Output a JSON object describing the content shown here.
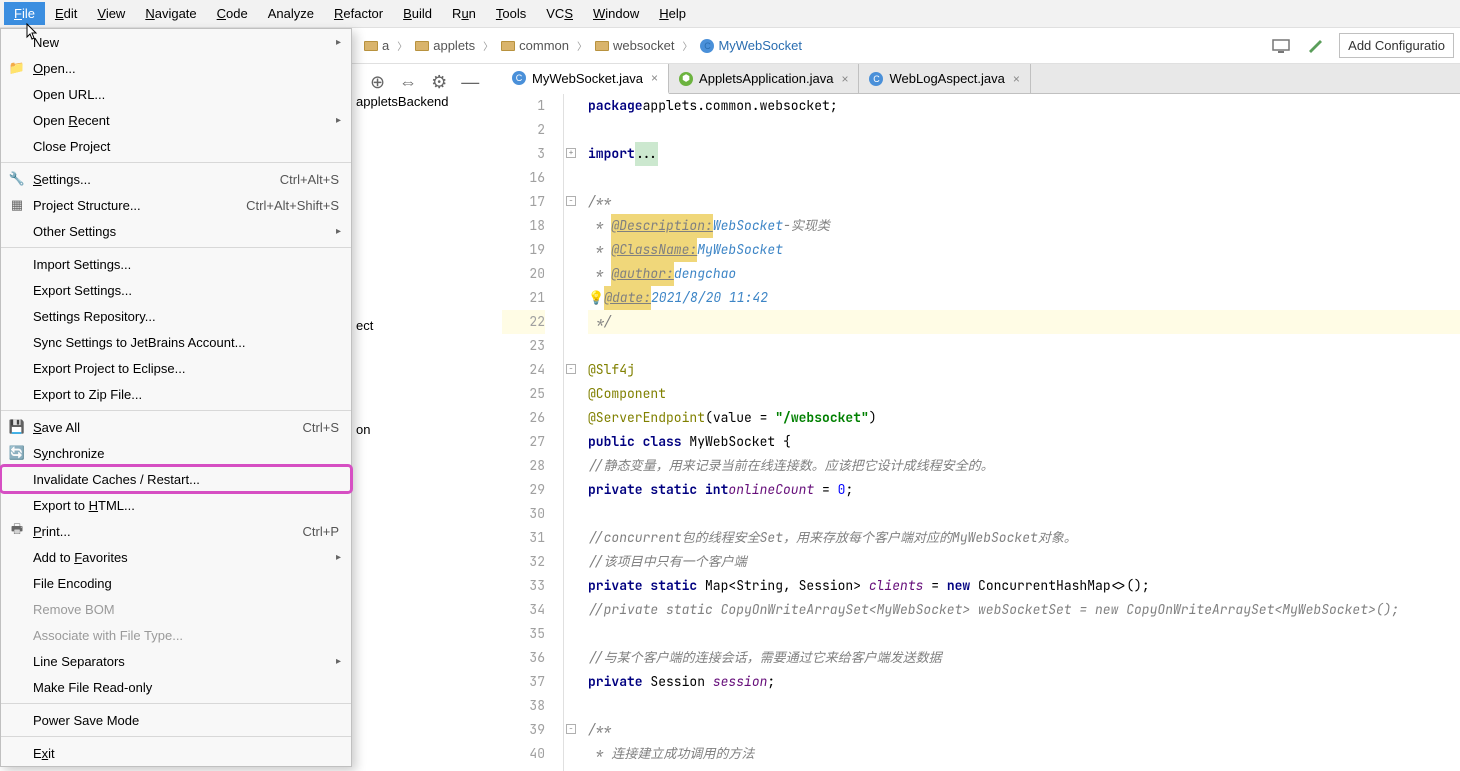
{
  "menubar": {
    "items": [
      {
        "label": "File",
        "u": "F"
      },
      {
        "label": "Edit",
        "u": "E"
      },
      {
        "label": "View",
        "u": "V"
      },
      {
        "label": "Navigate",
        "u": "N"
      },
      {
        "label": "Code",
        "u": "C"
      },
      {
        "label": "Analyze",
        "u": ""
      },
      {
        "label": "Refactor",
        "u": "R"
      },
      {
        "label": "Build",
        "u": "B"
      },
      {
        "label": "Run",
        "u": "u"
      },
      {
        "label": "Tools",
        "u": "T"
      },
      {
        "label": "VCS",
        "u": "S"
      },
      {
        "label": "Window",
        "u": "W"
      },
      {
        "label": "Help",
        "u": "H"
      }
    ]
  },
  "breadcrumb": {
    "segs": [
      {
        "label": "a",
        "icon": "folder"
      },
      {
        "label": "applets",
        "icon": "folder"
      },
      {
        "label": "common",
        "icon": "folder"
      },
      {
        "label": "websocket",
        "icon": "folder"
      },
      {
        "label": "MyWebSocket",
        "icon": "class",
        "link": true
      }
    ]
  },
  "addConfig": "Add Configuratio",
  "file_menu": [
    {
      "type": "item",
      "label": "New",
      "sub": true
    },
    {
      "type": "item",
      "label": "Open...",
      "icon": "folder-icon",
      "u": "O"
    },
    {
      "type": "item",
      "label": "Open URL..."
    },
    {
      "type": "item",
      "label": "Open Recent",
      "sub": true,
      "u": "R"
    },
    {
      "type": "item",
      "label": "Close Project",
      "u": "j"
    },
    {
      "type": "sep"
    },
    {
      "type": "item",
      "label": "Settings...",
      "icon": "wrench-icon",
      "shortcut": "Ctrl+Alt+S",
      "u": "S"
    },
    {
      "type": "item",
      "label": "Project Structure...",
      "icon": "project-structure-icon",
      "shortcut": "Ctrl+Alt+Shift+S"
    },
    {
      "type": "item",
      "label": "Other Settings",
      "sub": true
    },
    {
      "type": "sep"
    },
    {
      "type": "item",
      "label": "Import Settings..."
    },
    {
      "type": "item",
      "label": "Export Settings..."
    },
    {
      "type": "item",
      "label": "Settings Repository..."
    },
    {
      "type": "item",
      "label": "Sync Settings to JetBrains Account..."
    },
    {
      "type": "item",
      "label": "Export Project to Eclipse..."
    },
    {
      "type": "item",
      "label": "Export to Zip File..."
    },
    {
      "type": "sep"
    },
    {
      "type": "item",
      "label": "Save All",
      "icon": "save-icon",
      "shortcut": "Ctrl+S",
      "u": "S"
    },
    {
      "type": "item",
      "label": "Synchronize",
      "icon": "sync-icon",
      "u": "y"
    },
    {
      "type": "item",
      "label": "Invalidate Caches / Restart...",
      "highlight": true
    },
    {
      "type": "item",
      "label": "Export to HTML...",
      "u": "H"
    },
    {
      "type": "item",
      "label": "Print...",
      "icon": "print-icon",
      "shortcut": "Ctrl+P",
      "u": "P"
    },
    {
      "type": "item",
      "label": "Add to Favorites",
      "sub": true,
      "u": "F"
    },
    {
      "type": "item",
      "label": "File Encoding"
    },
    {
      "type": "item",
      "label": "Remove BOM",
      "disabled": true
    },
    {
      "type": "item",
      "label": "Associate with File Type...",
      "disabled": true
    },
    {
      "type": "item",
      "label": "Line Separators",
      "sub": true
    },
    {
      "type": "item",
      "label": "Make File Read-only"
    },
    {
      "type": "sep"
    },
    {
      "type": "item",
      "label": "Power Save Mode"
    },
    {
      "type": "sep"
    },
    {
      "type": "item",
      "label": "Exit",
      "u": "x"
    }
  ],
  "tabs": [
    {
      "label": "MyWebSocket.java",
      "icon": "c",
      "active": true
    },
    {
      "label": "AppletsApplication.java",
      "icon": "spring"
    },
    {
      "label": "WebLogAspect.java",
      "icon": "c"
    }
  ],
  "proj": {
    "frag1": "appletsBackend",
    "frag2": "ect",
    "frag3": "on"
  },
  "code": {
    "lines": [
      {
        "n": 1,
        "html": "<span class='kw2'>package</span> <span class='pkg'>applets.common.websocket</span>;"
      },
      {
        "n": 2,
        "html": ""
      },
      {
        "n": 3,
        "html": "<span class='kw2'>import</span> <span class='strbg'>...</span>",
        "fold": "+"
      },
      {
        "n": 16,
        "html": ""
      },
      {
        "n": 17,
        "html": "<span class='doc'>/**</span>",
        "fold": "-"
      },
      {
        "n": 18,
        "html": "<span class='doc'> * </span><span class='doctag-hi'>@Description:</span> <span class='docval'>WebSocket</span><span class='doc'>-实现类</span>"
      },
      {
        "n": 19,
        "html": "<span class='doc'> * </span><span class='doctag-hi'>@ClassName:</span> <span class='docval'>MyWebSocket</span>"
      },
      {
        "n": 20,
        "html": "<span class='doc'> * </span><span class='doctag-hi'>@author:</span> <span class='docval'>dengchao</span>"
      },
      {
        "n": 21,
        "html": "<span class='bulb'>💡</span><span class='doctag-hi'>@date:</span> <span class='docval'>2021/8/20 11:42</span>"
      },
      {
        "n": 22,
        "html": "<span class='doc'> */</span>",
        "current": true,
        "fold": "-u"
      },
      {
        "n": 23,
        "html": ""
      },
      {
        "n": 24,
        "html": "<span class='ann'>@Slf4j</span>",
        "fold": "-"
      },
      {
        "n": 25,
        "html": "<span class='ann'>@Component</span>"
      },
      {
        "n": 26,
        "html": "<span class='ann'>@ServerEndpoint</span>(value = <span class='str'>\"/websocket\"</span>)",
        "fold": "-u"
      },
      {
        "n": 27,
        "html": "<span class='kw2'>public class</span> MyWebSocket {",
        "icon": "class"
      },
      {
        "n": 28,
        "html": "    <span class='cmt'>//静态变量，用来记录当前在线连接数。应该把它设计成线程安全的。</span>"
      },
      {
        "n": 29,
        "html": "    <span class='kw2'>private static int</span> <span class='fld'>onlineCount</span> = <span class='num'>0</span>;"
      },
      {
        "n": 30,
        "html": ""
      },
      {
        "n": 31,
        "html": "    <span class='cmt'>//concurrent包的线程安全Set，用来存放每个客户端对应的MyWebSocket对象。</span>"
      },
      {
        "n": 32,
        "html": "    <span class='cmt'>//该项目中只有一个客户端</span>"
      },
      {
        "n": 33,
        "html": "    <span class='kw2'>private static</span> Map&lt;String, Session&gt; <span class='fld'>clients</span> = <span class='kw2'>new</span> ConcurrentHashMap&lt;&gt;();"
      },
      {
        "n": 34,
        "html": "    <span class='cmt'>//private static CopyOnWriteArraySet&lt;MyWebSocket&gt; webSocketSet = new CopyOnWriteArraySet&lt;MyWebSocket&gt;();</span>"
      },
      {
        "n": 35,
        "html": ""
      },
      {
        "n": 36,
        "html": "    <span class='cmt'>//与某个客户端的连接会话，需要通过它来给客户端发送数据</span>"
      },
      {
        "n": 37,
        "html": "    <span class='kw2'>private</span> Session <span class='fld'>session</span>;"
      },
      {
        "n": 38,
        "html": ""
      },
      {
        "n": 39,
        "html": "    <span class='doc'>/**</span>",
        "fold": "-"
      },
      {
        "n": 40,
        "html": "    <span class='doc'> * 连接建立成功调用的方法</span>"
      }
    ]
  }
}
